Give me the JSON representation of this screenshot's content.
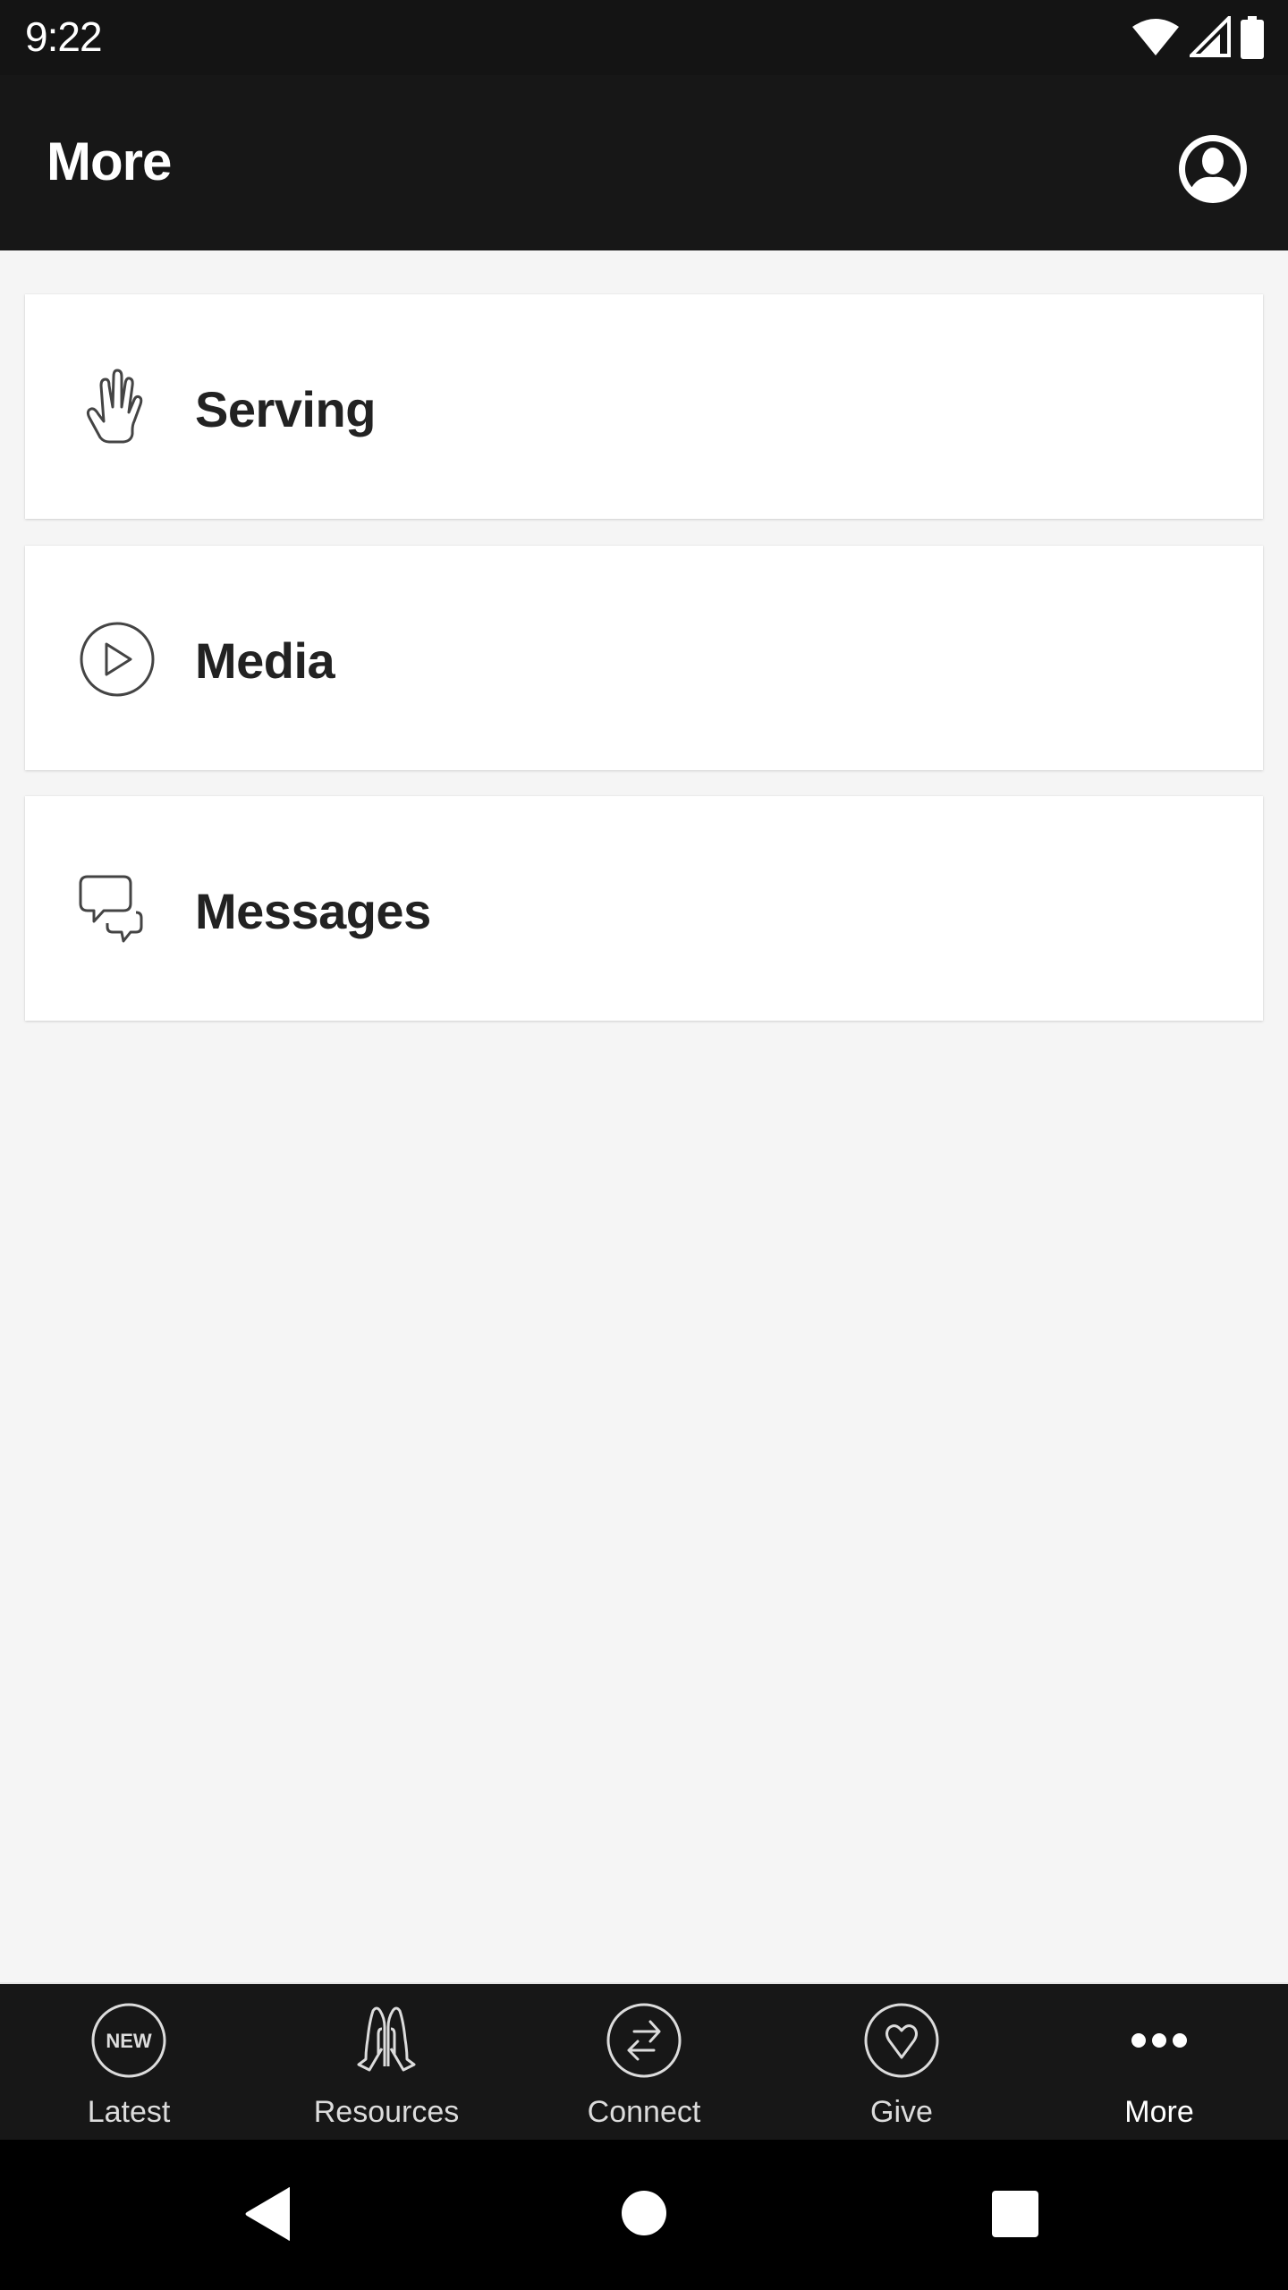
{
  "status_bar": {
    "time": "9:22",
    "icons": [
      "wifi-icon",
      "cell-signal-icon",
      "battery-icon"
    ]
  },
  "app_bar": {
    "title": "More",
    "profile_icon": "account-circle-icon"
  },
  "menu": {
    "items": [
      {
        "label": "Serving",
        "icon": "raised-hand-icon"
      },
      {
        "label": "Media",
        "icon": "play-circle-icon"
      },
      {
        "label": "Messages",
        "icon": "chat-bubbles-icon"
      }
    ]
  },
  "bottom_nav": {
    "active": "More",
    "items": [
      {
        "label": "Latest",
        "icon": "new-badge-icon",
        "badge_text": "NEW"
      },
      {
        "label": "Resources",
        "icon": "praying-hands-icon"
      },
      {
        "label": "Connect",
        "icon": "swap-arrows-icon"
      },
      {
        "label": "Give",
        "icon": "heart-circle-icon"
      },
      {
        "label": "More",
        "icon": "more-dots-icon"
      }
    ]
  },
  "system_nav": {
    "buttons": [
      "back-icon",
      "home-icon",
      "recents-icon"
    ]
  },
  "colors": {
    "app_bar_bg": "#171717",
    "status_bar_bg": "#141414",
    "content_bg": "#f5f5f5",
    "card_bg": "#ffffff",
    "card_text": "#222222",
    "icon_stroke": "#444444",
    "nav_text": "#dcdcdc",
    "nav_active_text": "#ffffff"
  }
}
